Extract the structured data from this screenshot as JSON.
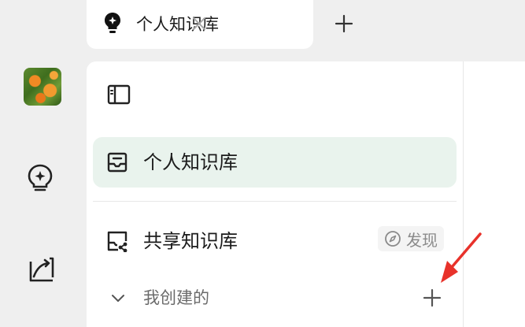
{
  "tab": {
    "title": "个人知识库"
  },
  "sidebar": {
    "active_item": {
      "label": "个人知识库"
    },
    "shared_item": {
      "label": "共享知识库",
      "discover_label": "发现"
    },
    "group": {
      "label": "我创建的"
    }
  },
  "colors": {
    "active_bg": "#e9f3ed",
    "arrow": "#e8322b",
    "background": "#efefef"
  },
  "icons": [
    "bulb-icon",
    "close-icon",
    "plus-icon",
    "avatar",
    "chart-icon",
    "sidebar-toggle-icon",
    "knowledge-base-icon",
    "shared-kb-icon",
    "compass-icon",
    "chevron-down-icon"
  ]
}
